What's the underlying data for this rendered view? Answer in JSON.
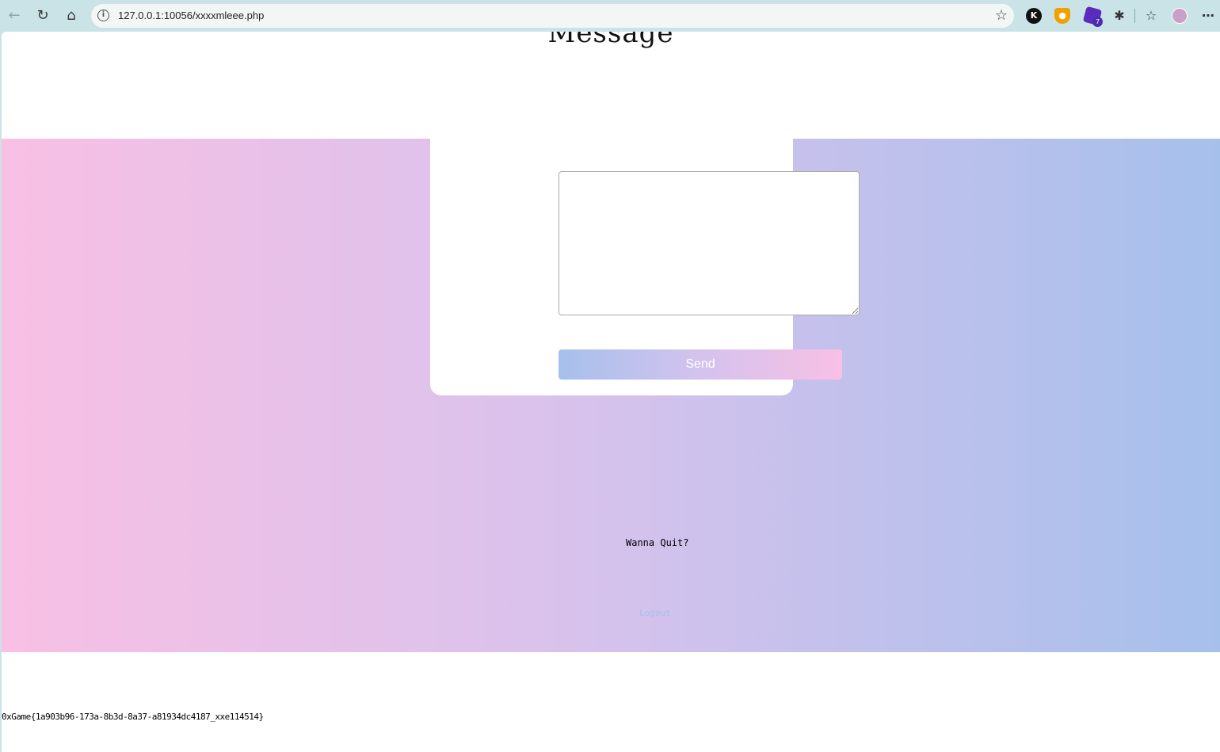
{
  "browser": {
    "url": "127.0.0.1:10056/xxxxmleee.php",
    "extensions": {
      "k_label": "K",
      "badge_count": "7"
    }
  },
  "page": {
    "heading": "Message",
    "message_box": {
      "value": "",
      "placeholder": ""
    },
    "send_label": "Send",
    "quit_prompt": "Wanna Quit?",
    "logout_label": "Logout",
    "flag": "0xGame{1a903b96-173a-8b3d-8a37-a81934dc4187_xxe114514}"
  }
}
